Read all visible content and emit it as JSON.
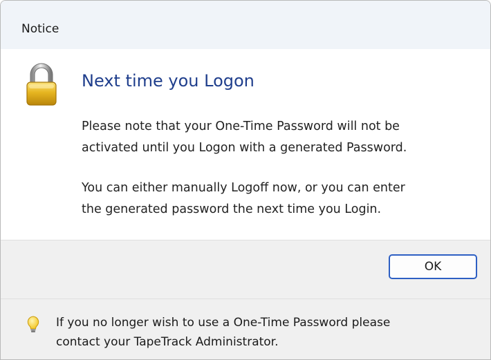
{
  "window": {
    "title": "Notice"
  },
  "dialog": {
    "heading": "Next time you Logon",
    "message_1_line_1": "Please note that your One-Time Password will not be",
    "message_1_line_2": "activated until you Logon with a generated Password.",
    "message_2_line_1": "You can either manually Logoff now, or you can enter",
    "message_2_line_2": "the generated password the next time you Login.",
    "main_icon": "lock-icon"
  },
  "buttons": {
    "ok_label": "OK"
  },
  "footer": {
    "icon": "lightbulb-icon",
    "line_1": "If you no longer wish to use a One-Time Password please",
    "line_2": "contact your TapeTrack Administrator."
  },
  "colors": {
    "heading": "#1f3e8c",
    "button_border": "#2d5fc3",
    "title_background": "#f0f4f9",
    "panel_background": "#f0f0f0"
  }
}
